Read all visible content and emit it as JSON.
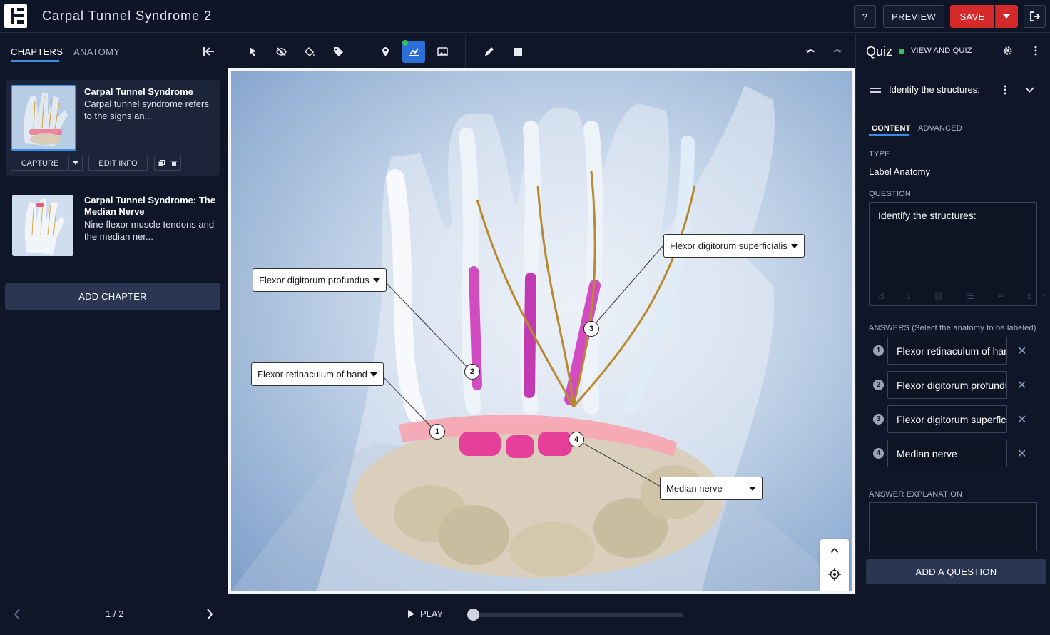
{
  "header": {
    "title": "Carpal Tunnel Syndrome 2",
    "help_label": "?",
    "preview_label": "PREVIEW",
    "save_label": "SAVE"
  },
  "left": {
    "tabs": [
      "CHAPTERS",
      "ANATOMY"
    ],
    "chapters": [
      {
        "title": "Carpal Tunnel Syndrome",
        "desc": "Carpal tunnel syndrome refers to the signs an..."
      },
      {
        "title": "Carpal Tunnel Syndrome: The Median Nerve",
        "desc": "Nine flexor muscle tendons and the median ner..."
      }
    ],
    "capture_label": "CAPTURE",
    "edit_info_label": "EDIT INFO",
    "add_chapter_label": "ADD CHAPTER"
  },
  "toolbar": {
    "tools": [
      "select-icon",
      "hide-icon",
      "paint-icon",
      "tag-icon",
      "pin-icon",
      "label-anatomy-icon",
      "image-icon",
      "pencil-icon",
      "square-icon",
      "undo-icon",
      "redo-icon"
    ],
    "active_tool": "label-anatomy-icon",
    "active_color": "#2a6fd6"
  },
  "scene": {
    "labels": [
      {
        "text": "Flexor digitorum superficialis",
        "marker": "3"
      },
      {
        "text": "Flexor digitorum profundus",
        "marker": "2"
      },
      {
        "text": "Flexor retinaculum of hand",
        "marker": "1"
      },
      {
        "text": "Median nerve",
        "marker": "4"
      }
    ]
  },
  "footer": {
    "page_indicator": "1 / 2",
    "play_label": "PLAY",
    "progress": 0.0
  },
  "quiz": {
    "title": "Quiz",
    "mode": "VIEW AND QUIZ",
    "status_color": "#3bbf5e",
    "question_header": "Identify the structures:",
    "tabs": [
      "CONTENT",
      "ADVANCED"
    ],
    "type_label": "TYPE",
    "type_value": "Label Anatomy",
    "question_label": "QUESTION",
    "question_text": "Identify the structures:",
    "answers_label": "ANSWERS (Select the anatomy to be labeled)",
    "answers": [
      {
        "num": "1",
        "value": "Flexor retinaculum of hand"
      },
      {
        "num": "2",
        "value": "Flexor digitorum profundus"
      },
      {
        "num": "3",
        "value": "Flexor digitorum superficialis"
      },
      {
        "num": "4",
        "value": "Median nerve"
      }
    ],
    "explanation_label": "ANSWER EXPLANATION",
    "add_question_label": "ADD A QUESTION"
  }
}
